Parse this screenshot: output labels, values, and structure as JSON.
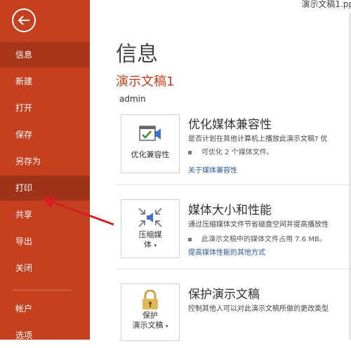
{
  "window": {
    "file_title": "演示文稿1.pp"
  },
  "sidebar": {
    "items": [
      {
        "label": "信息"
      },
      {
        "label": "新建"
      },
      {
        "label": "打开"
      },
      {
        "label": "保存"
      },
      {
        "label": "另存为"
      },
      {
        "label": "打印"
      },
      {
        "label": "共享"
      },
      {
        "label": "导出"
      },
      {
        "label": "关闭"
      },
      {
        "label": "帐户"
      },
      {
        "label": "选项"
      }
    ],
    "bg_color": "#c4401f",
    "active_color": "#a9351a"
  },
  "main": {
    "title": "信息",
    "doc_name": "演示文稿1",
    "author": "admin",
    "sections": [
      {
        "button_label": "优化兼容性",
        "title": "优化媒体兼容性",
        "desc": "是否计划在其他计算机上播放此演示文稿? 优",
        "bullet": "可优化 2 个媒体文件。",
        "link": "关于媒体兼容性",
        "icon": "media-compat-icon"
      },
      {
        "button_label_1": "压缩媒",
        "button_label_2": "体",
        "title": "媒体大小和性能",
        "desc": "通过压缩媒体文件节省磁盘空间并提高播放性",
        "bullet": "此演示文稿中的媒体文件占用 7.6 MB。",
        "link": "提高媒体性能的其他方式",
        "icon": "compress-media-icon"
      },
      {
        "button_label_1": "保护",
        "button_label_2": "演示文稿",
        "title": "保护演示文稿",
        "desc": "控制其他人可以对此演示文稿所做的更改类型",
        "icon": "lock-icon"
      }
    ]
  },
  "annotation": {
    "arrow_color": "#d22020"
  }
}
